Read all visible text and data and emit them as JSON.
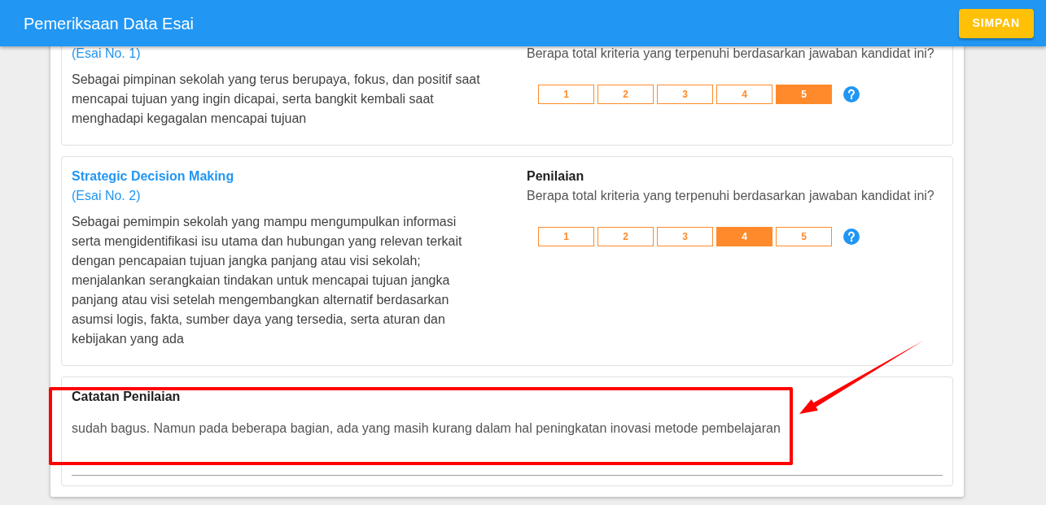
{
  "app_bar": {
    "title": "Pemeriksaan Data Esai",
    "save_button": "SIMPAN"
  },
  "essays": [
    {
      "essay_no": "(Esai No. 1)",
      "description": "Sebagai pimpinan sekolah yang terus berupaya, fokus, dan positif saat mencapai tujuan yang ingin dicapai, serta bangkit kembali saat menghadapi kegagalan mencapai tujuan",
      "question": "Berapa total kriteria yang terpenuhi berdasarkan jawaban kandidat ini?",
      "scores": [
        {
          "label": "1",
          "selected": false
        },
        {
          "label": "2",
          "selected": false
        },
        {
          "label": "3",
          "selected": false
        },
        {
          "label": "4",
          "selected": false
        },
        {
          "label": "5",
          "selected": true
        }
      ]
    },
    {
      "competency": "Strategic Decision Making",
      "essay_no": "(Esai No. 2)",
      "description": "Sebagai pemimpin sekolah yang mampu mengumpulkan informasi serta mengidentifikasi isu utama dan hubungan yang relevan terkait dengan pencapaian tujuan jangka panjang atau visi sekolah; menjalankan serangkaian tindakan untuk mencapai tujuan jangka panjang atau visi setelah mengembangkan alternatif berdasarkan asumsi logis, fakta, sumber daya yang tersedia, serta aturan dan kebijakan yang ada",
      "rating_heading": "Penilaian",
      "question": "Berapa total kriteria yang terpenuhi berdasarkan jawaban kandidat ini?",
      "scores": [
        {
          "label": "1",
          "selected": false
        },
        {
          "label": "2",
          "selected": false
        },
        {
          "label": "3",
          "selected": false
        },
        {
          "label": "4",
          "selected": true
        },
        {
          "label": "5",
          "selected": false
        }
      ]
    }
  ],
  "notes": {
    "label": "Catatan Penilaian",
    "value": "sudah bagus. Namun pada beberapa bagian, ada yang masih kurang dalam hal peningkatan inovasi metode pembelajaran"
  }
}
